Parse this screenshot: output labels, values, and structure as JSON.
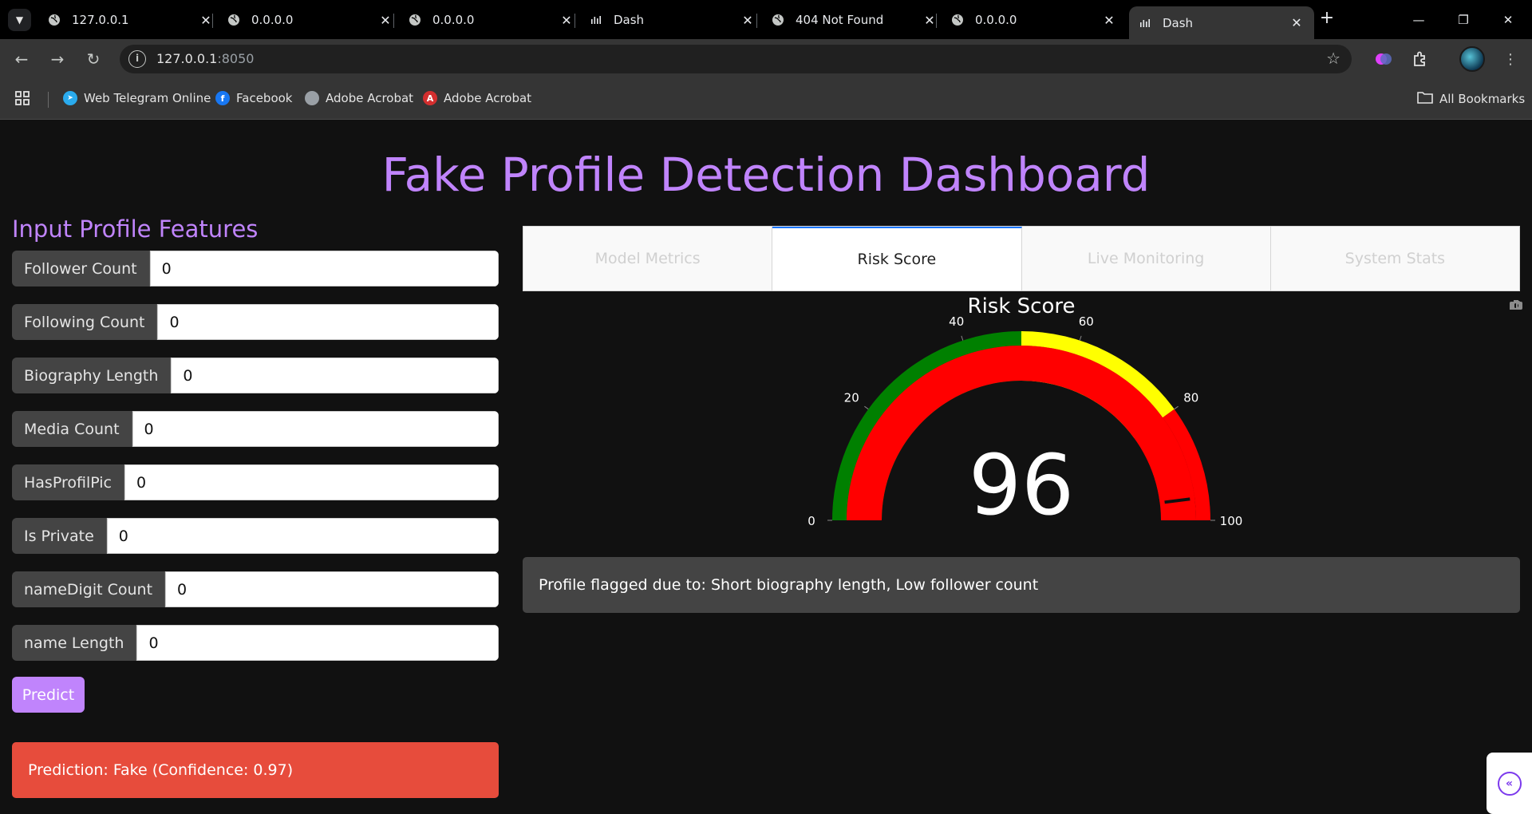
{
  "browser": {
    "tabs": [
      {
        "title": "127.0.0.1",
        "icon": "globe-icon",
        "active": false
      },
      {
        "title": "0.0.0.0",
        "icon": "globe-icon",
        "active": false
      },
      {
        "title": "0.0.0.0",
        "icon": "globe-icon",
        "active": false
      },
      {
        "title": "Dash",
        "icon": "dash-icon",
        "active": false
      },
      {
        "title": "404 Not Found",
        "icon": "globe-icon",
        "active": false
      },
      {
        "title": "0.0.0.0",
        "icon": "globe-icon",
        "active": false
      },
      {
        "title": "Dash",
        "icon": "dash-icon",
        "active": true
      }
    ],
    "address": {
      "host": "127.0.0.1",
      "port": ":8050"
    },
    "bookmarks": [
      {
        "label": "Web Telegram Online",
        "icon": "telegram-icon",
        "color": "#2AABEE"
      },
      {
        "label": "Facebook",
        "icon": "facebook-icon",
        "color": "#1877F2"
      },
      {
        "label": "Adobe Acrobat",
        "icon": "globe-icon",
        "color": "#9aa0a6"
      },
      {
        "label": "Adobe Acrobat",
        "icon": "acrobat-icon",
        "color": "#D32F2F"
      }
    ],
    "all_bookmarks": "All Bookmarks"
  },
  "dashboard": {
    "title": "Fake Profile Detection Dashboard",
    "input_heading": "Input Profile Features",
    "fields": [
      {
        "label": "Follower Count",
        "value": "0"
      },
      {
        "label": "Following Count",
        "value": "0"
      },
      {
        "label": "Biography Length",
        "value": "0"
      },
      {
        "label": "Media Count",
        "value": "0"
      },
      {
        "label": "HasProfilPic",
        "value": "0"
      },
      {
        "label": "Is Private",
        "value": "0"
      },
      {
        "label": "nameDigit Count",
        "value": "0"
      },
      {
        "label": "name Length",
        "value": "0"
      }
    ],
    "predict_label": "Predict",
    "prediction_text": "Prediction: Fake (Confidence: 0.97)",
    "tabs": [
      {
        "label": "Model Metrics",
        "selected": false
      },
      {
        "label": "Risk Score",
        "selected": true
      },
      {
        "label": "Live Monitoring",
        "selected": false
      },
      {
        "label": "System Stats",
        "selected": false
      }
    ],
    "reason_text": "Profile flagged due to: Short biography length, Low follower count"
  },
  "chart_data": {
    "type": "gauge",
    "title": "Risk Score",
    "value": 96,
    "range": [
      0,
      100
    ],
    "ticks": [
      0,
      20,
      40,
      60,
      80,
      100
    ],
    "bar_color": "#ff0000",
    "steps": [
      {
        "range": [
          0,
          50
        ],
        "color": "#008000"
      },
      {
        "range": [
          50,
          80
        ],
        "color": "#ffff00"
      },
      {
        "range": [
          80,
          100
        ],
        "color": "#ff0000"
      }
    ]
  },
  "colors": {
    "accent": "#c084fc",
    "danger": "#e74c3c",
    "tab_selected_border": "#1975fa"
  }
}
